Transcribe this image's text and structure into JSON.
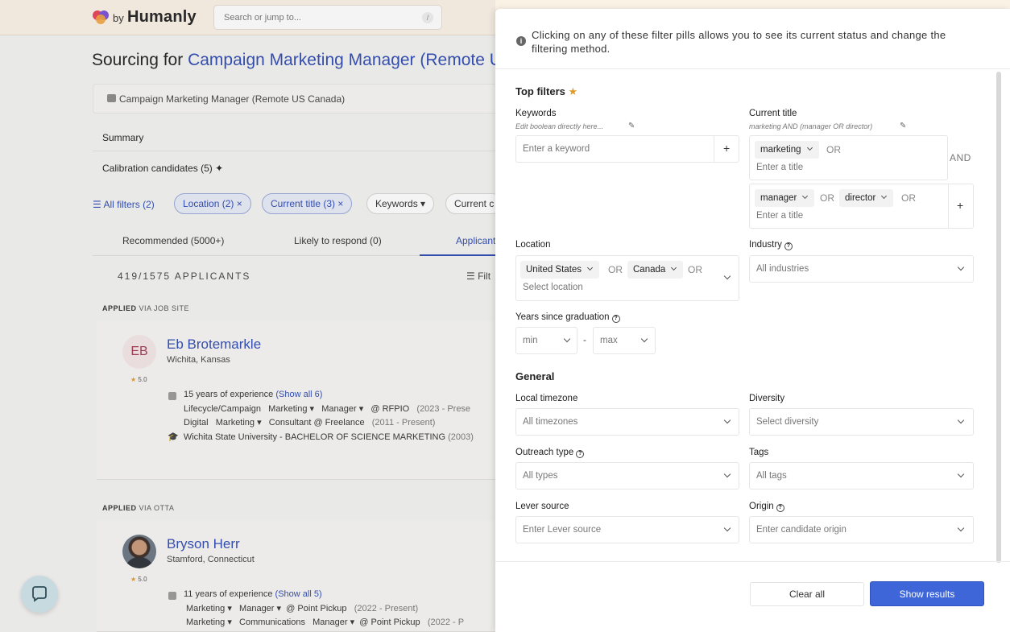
{
  "app": {
    "brand_by": "by",
    "brand_name": "Humanly"
  },
  "search": {
    "placeholder": "Search or jump to..."
  },
  "page": {
    "title_prefix": "Sourcing for",
    "title_role": "Campaign Marketing Manager (Remote U",
    "job_label": "Campaign Marketing Manager (Remote US Canada)",
    "summary": "Summary",
    "calibration": "Calibration candidates (5)"
  },
  "filter_bar": {
    "all_filters": "All filters (2)",
    "pills": [
      "Location (2)",
      "Current title (3)",
      "Keywords",
      "Current c"
    ]
  },
  "tabs": [
    "Recommended (5000+)",
    "Likely to respond (0)",
    "Applicants"
  ],
  "applicants": {
    "count": "419/1575 APPLICANTS",
    "filter": "Filt"
  },
  "candidates": [
    {
      "applied_label": "APPLIED",
      "applied_via": "VIA JOB SITE",
      "initials": "EB",
      "rating": "5.0",
      "name": "Eb Brotemarkle",
      "location": "Wichita, Kansas",
      "experience": "15 years of experience",
      "show_all": "(Show all 6)",
      "line1": [
        "Lifecycle/Campaign",
        "Marketing",
        "Manager",
        "@ RFPIO",
        "(2023 - Prese"
      ],
      "line2": [
        "Digital",
        "Marketing",
        "Consultant",
        "@ Freelance",
        "(2011 - Present)"
      ],
      "education": "Wichita State University - BACHELOR OF SCIENCE MARKETING",
      "education_year": "(2003)"
    },
    {
      "applied_label": "APPLIED",
      "applied_via": "VIA OTTA",
      "rating": "5.0",
      "name": "Bryson Herr",
      "location": "Stamford, Connecticut",
      "experience": "11 years of experience",
      "show_all": "(Show all 5)",
      "line1": [
        "Marketing",
        "Manager",
        "@ Point Pickup",
        "(2022 - Present)"
      ],
      "line2": [
        "Marketing",
        "Communications",
        "Manager",
        "@ Point Pickup",
        "(2022 - P"
      ]
    }
  ],
  "panel": {
    "info": "Clicking on any of these filter pills allows you to see its current status and change the filtering method.",
    "top_filters": "Top filters",
    "keywords": {
      "label": "Keywords",
      "hint": "Edit boolean directly here...",
      "placeholder": "Enter a keyword"
    },
    "current_title": {
      "label": "Current title",
      "hint": "marketing AND (manager OR director)",
      "group1": [
        "marketing"
      ],
      "group2": [
        "manager",
        "director"
      ],
      "placeholder": "Enter a title",
      "or": "OR",
      "and": "AND"
    },
    "location": {
      "label": "Location",
      "chips": [
        "United States",
        "Canada"
      ],
      "placeholder": "Select location",
      "or": "OR"
    },
    "industry": {
      "label": "Industry",
      "placeholder": "All industries"
    },
    "years_since_graduation": {
      "label": "Years since graduation",
      "min": "min",
      "max": "max",
      "dash": "-"
    },
    "general": "General",
    "local_timezone": {
      "label": "Local timezone",
      "placeholder": "All timezones"
    },
    "diversity": {
      "label": "Diversity",
      "placeholder": "Select diversity"
    },
    "outreach_type": {
      "label": "Outreach type",
      "placeholder": "All types"
    },
    "tags": {
      "label": "Tags",
      "placeholder": "All tags"
    },
    "lever_source": {
      "label": "Lever source",
      "placeholder": "Enter Lever source"
    },
    "origin": {
      "label": "Origin",
      "placeholder": "Enter candidate origin"
    },
    "clear_all": "Clear all",
    "show_results": "Show results"
  },
  "colors": {
    "accent": "#2f4bb4",
    "primary_button": "#3f66d8",
    "star": "#e09b2b"
  }
}
